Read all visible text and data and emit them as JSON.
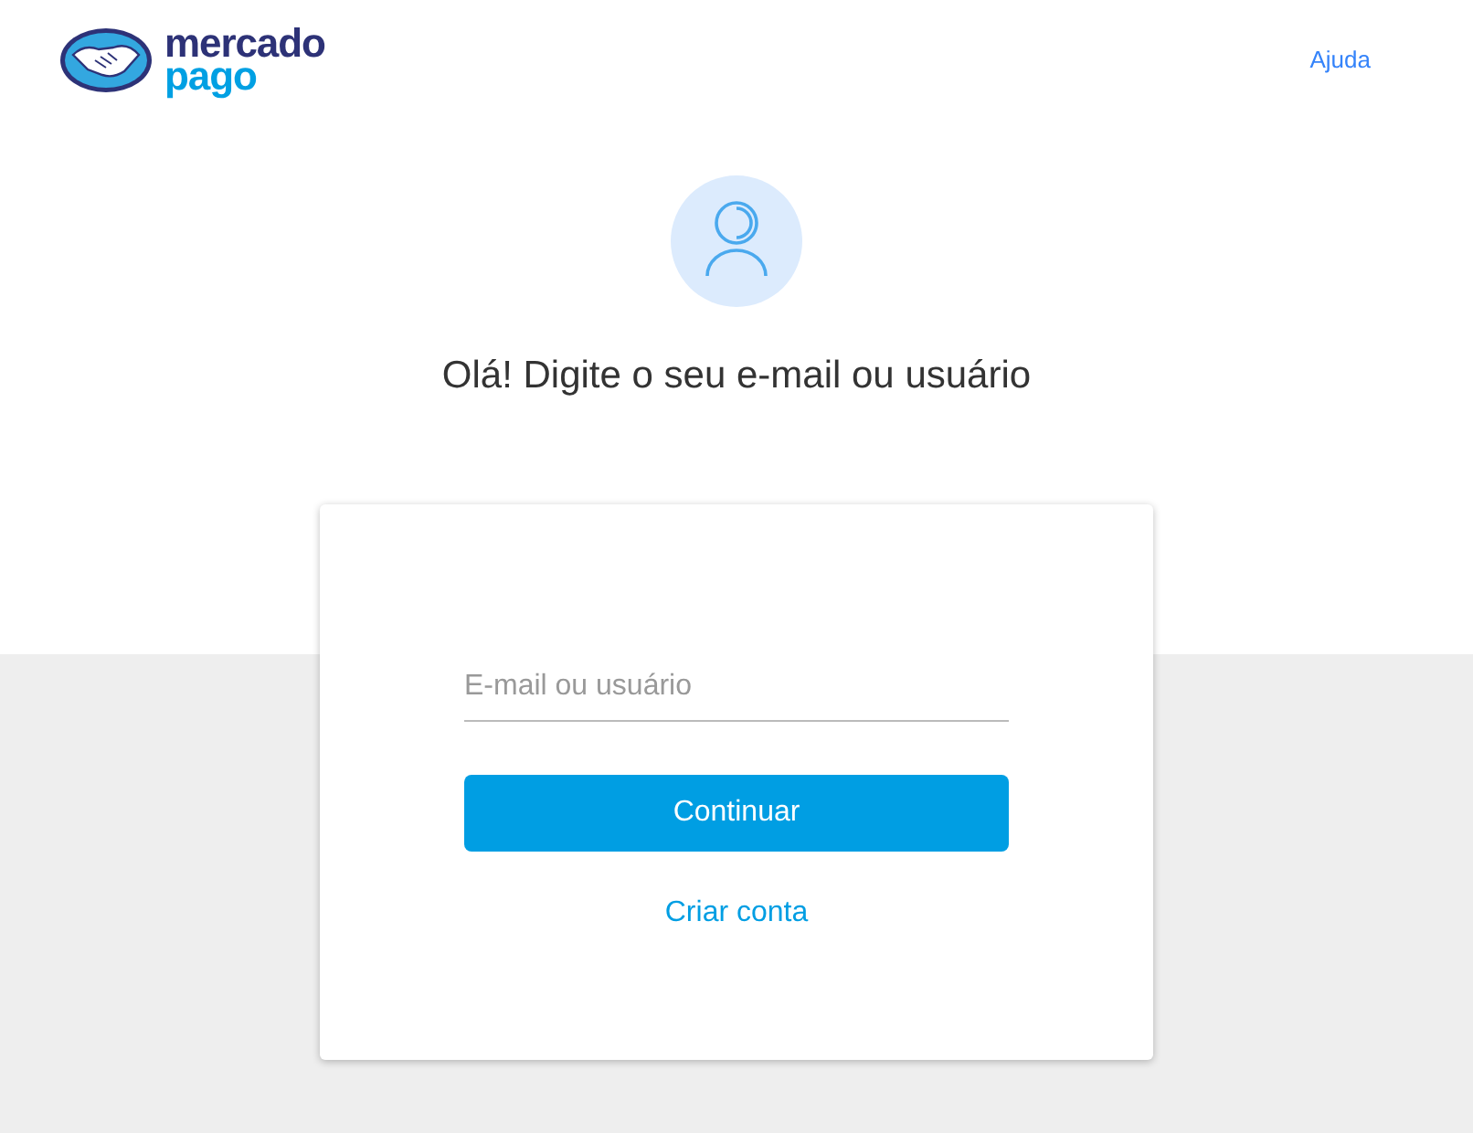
{
  "header": {
    "logo": {
      "line_1": "mercado",
      "line_2": "pago"
    },
    "help_link": "Ajuda"
  },
  "heading": "Olá! Digite o seu e-mail ou usuário",
  "form": {
    "email_field": {
      "placeholder": "E-mail ou usuário"
    },
    "continue_button": "Continuar",
    "create_account_link": "Criar conta"
  }
}
